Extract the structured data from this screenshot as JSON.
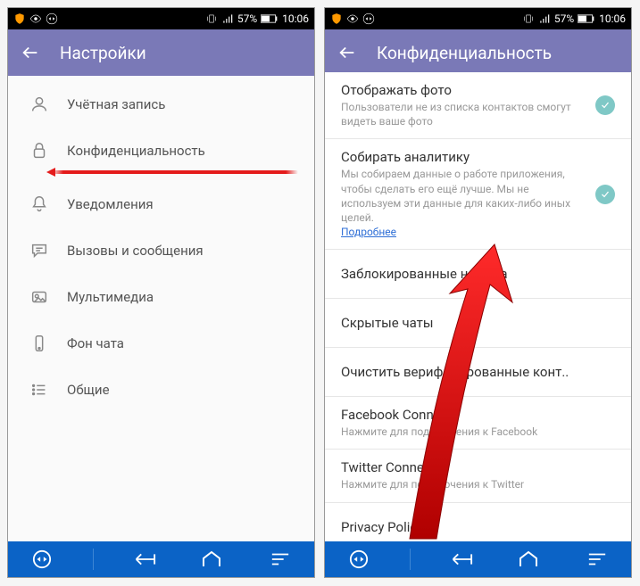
{
  "status": {
    "battery": "57%",
    "time": "10:06"
  },
  "screen1": {
    "title": "Настройки",
    "items": [
      {
        "label": "Учётная запись"
      },
      {
        "label": "Конфиденциальность"
      },
      {
        "label": "Уведомления"
      },
      {
        "label": "Вызовы и сообщения"
      },
      {
        "label": "Мультимедиа"
      },
      {
        "label": "Фон чата"
      },
      {
        "label": "Общие"
      }
    ]
  },
  "screen2": {
    "title": "Конфиденциальность",
    "items": [
      {
        "title": "Отображать фото",
        "sub": "Пользователи не из списка контактов смогут видеть ваше фото",
        "toggle": true,
        "link": ""
      },
      {
        "title": "Собирать аналитику",
        "sub": "Мы собираем данные о работе приложения, чтобы сделать его ещё лучше. Мы не используем эти данные для каких-либо иных целей.",
        "toggle": true,
        "link": "Подробнее"
      },
      {
        "title": "Заблокированные номера",
        "sub": "",
        "toggle": false,
        "link": ""
      },
      {
        "title": "Скрытые чаты",
        "sub": "",
        "toggle": false,
        "link": ""
      },
      {
        "title": "Очистить верифицированные конт..",
        "sub": "",
        "toggle": false,
        "link": ""
      },
      {
        "title": "Facebook Connect",
        "sub": "Нажмите для подключения к Facebook",
        "toggle": false,
        "link": ""
      },
      {
        "title": "Twitter Connect",
        "sub": "Нажмите для подключения к Twitter",
        "toggle": false,
        "link": ""
      },
      {
        "title": "Privacy Policy",
        "sub": "",
        "toggle": false,
        "link": ""
      }
    ]
  }
}
